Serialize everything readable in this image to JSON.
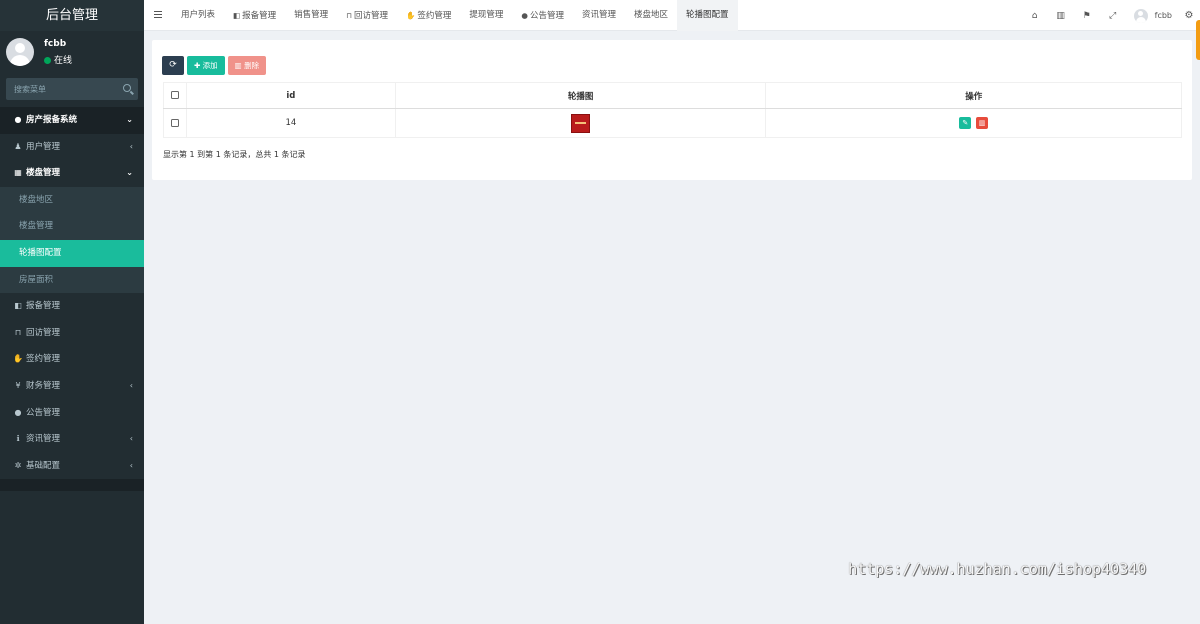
{
  "sidebar": {
    "brand": "后台管理",
    "user": {
      "name": "fcbb",
      "status": "在线"
    },
    "search": {
      "placeholder": "搜索菜单"
    },
    "menu": {
      "header": {
        "label": "房产报备系统",
        "icon": "comments-icon"
      },
      "items": [
        {
          "label": "用户管理",
          "icon": "user-icon"
        },
        {
          "label": "楼盘管理",
          "icon": "building-icon"
        },
        {
          "label": "报备管理",
          "icon": "book-icon"
        },
        {
          "label": "回访管理",
          "icon": "lock-icon"
        },
        {
          "label": "签约管理",
          "icon": "handshake-icon"
        },
        {
          "label": "财务管理",
          "icon": "yen-icon"
        },
        {
          "label": "公告管理",
          "icon": "comments-icon"
        },
        {
          "label": "资讯管理",
          "icon": "info-icon"
        },
        {
          "label": "基础配置",
          "icon": "gear-icon"
        }
      ],
      "sub_items": [
        {
          "label": "楼盘地区"
        },
        {
          "label": "楼盘管理"
        },
        {
          "label": "轮播图配置"
        },
        {
          "label": "房屋面积"
        }
      ]
    }
  },
  "topnav": {
    "tabs": [
      {
        "label": "用户列表"
      },
      {
        "label": "报备管理"
      },
      {
        "label": "销售管理"
      },
      {
        "label": "回访管理"
      },
      {
        "label": "签约管理"
      },
      {
        "label": "提现管理"
      },
      {
        "label": "公告管理"
      },
      {
        "label": "资讯管理"
      },
      {
        "label": "楼盘地区"
      },
      {
        "label": "轮播图配置"
      }
    ],
    "user": "fcbb"
  },
  "toolbar": {
    "add_label": "添加",
    "delete_label": "删除"
  },
  "table": {
    "columns": [
      "id",
      "轮播图",
      "操作"
    ],
    "rows": [
      {
        "id": "14"
      }
    ]
  },
  "pagination": {
    "info": "显示第 1 到第 1 条记录，总共 1 条记录"
  },
  "watermark": "https://www.huzhan.com/ishop40340",
  "colors": {
    "sidebar": "#222d32",
    "accent": "#1abc9c",
    "danger": "#e74c3c"
  }
}
